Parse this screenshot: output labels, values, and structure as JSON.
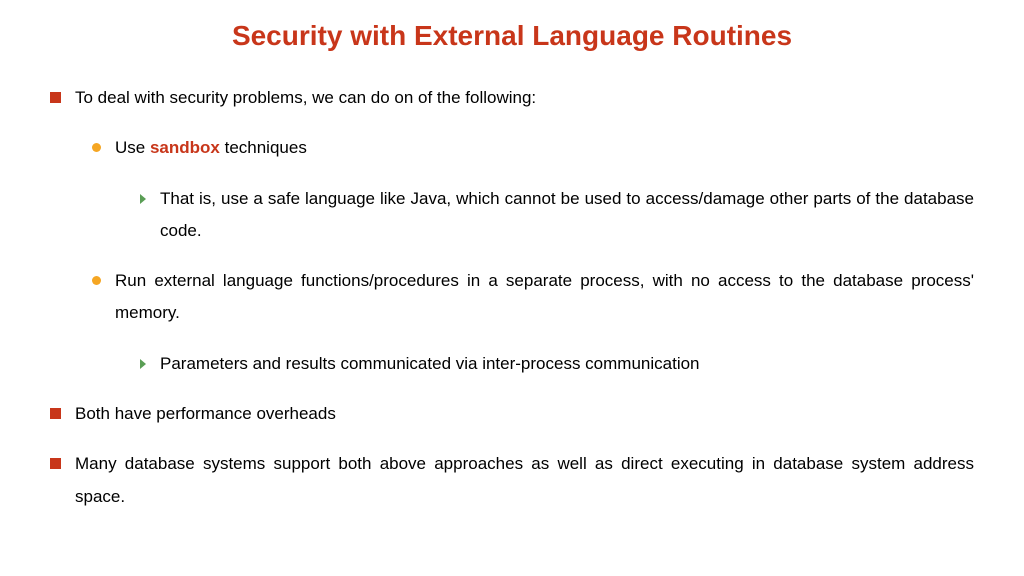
{
  "title": "Security with External Language Routines",
  "items": {
    "l1a": "To deal with security problems, we can do on of the following:",
    "l2a_pre": "Use ",
    "l2a_bold": "sandbox",
    "l2a_post": " techniques",
    "l3a": "That is, use a safe language like Java, which cannot be used to  access/damage other parts of the database code.",
    "l2b": "Run external language functions/procedures in a separate process, with no access to the database process' memory.",
    "l3b": "Parameters and results communicated via inter-process communication",
    "l1b": "Both have performance overheads",
    "l1c": "Many database systems support both above approaches as well as direct executing in database system address space."
  }
}
